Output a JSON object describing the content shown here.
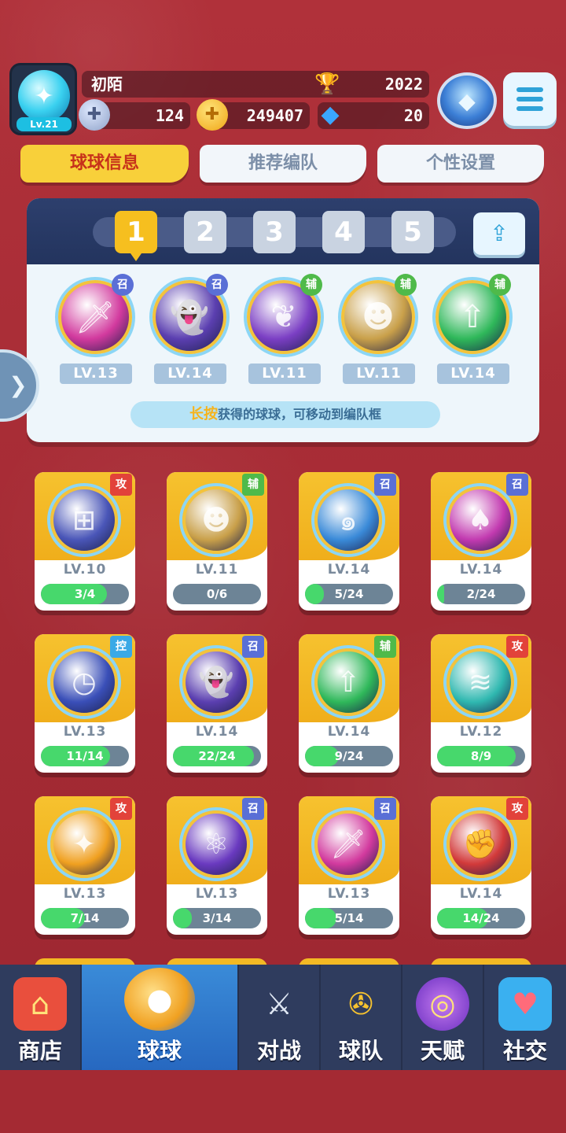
{
  "player": {
    "avatar_level": "Lv.21",
    "name": "初陌",
    "trophy_count": "2022",
    "energy": "124",
    "coins": "249407",
    "gems": "20"
  },
  "tabs": [
    {
      "label": "球球信息",
      "active": true
    },
    {
      "label": "推荐编队",
      "active": false
    },
    {
      "label": "个性设置",
      "active": false
    }
  ],
  "lineup": {
    "slots": [
      "1",
      "2",
      "3",
      "4",
      "5"
    ],
    "active_slot": "1",
    "balls": [
      {
        "role": "召",
        "level": "LV.13",
        "icon": "sword-icon",
        "color": "#d23a9e"
      },
      {
        "role": "召",
        "level": "LV.14",
        "icon": "ghost-icon",
        "color": "#5b3fb0"
      },
      {
        "role": "辅",
        "level": "LV.11",
        "icon": "leaf-icon",
        "color": "#7b3fc4"
      },
      {
        "role": "辅",
        "level": "LV.11",
        "icon": "people-icon",
        "color": "#c9a04a"
      },
      {
        "role": "辅",
        "level": "LV.14",
        "icon": "star-arrow-icon",
        "color": "#2fb85a"
      }
    ],
    "hint_bold": "长按",
    "hint_text": "获得的球球，可移动到编队框"
  },
  "balls": [
    {
      "type": "攻",
      "level": "LV.10",
      "progress": "3/4",
      "fill": 0.75,
      "icon": "dice-icon",
      "color": "#4a56b8"
    },
    {
      "type": "辅",
      "level": "LV.11",
      "progress": "0/6",
      "fill": 0.0,
      "icon": "people-icon",
      "color": "#c9a04a"
    },
    {
      "type": "召",
      "level": "LV.14",
      "progress": "5/24",
      "fill": 0.21,
      "icon": "vortex-icon",
      "color": "#3a8ad8"
    },
    {
      "type": "召",
      "level": "LV.14",
      "progress": "2/24",
      "fill": 0.08,
      "icon": "mushroom-icon",
      "color": "#c23ab0"
    },
    {
      "type": "控",
      "level": "LV.13",
      "progress": "11/14",
      "fill": 0.79,
      "icon": "clock-icon",
      "color": "#3a4fb8"
    },
    {
      "type": "召",
      "level": "LV.14",
      "progress": "22/24",
      "fill": 0.92,
      "icon": "ghost-icon",
      "color": "#5b3fb0"
    },
    {
      "type": "辅",
      "level": "LV.14",
      "progress": "9/24",
      "fill": 0.38,
      "icon": "star-arrow-icon",
      "color": "#2fb85a"
    },
    {
      "type": "攻",
      "level": "LV.12",
      "progress": "8/9",
      "fill": 0.89,
      "icon": "tornado-icon",
      "color": "#2fb8b0"
    },
    {
      "type": "攻",
      "level": "LV.13",
      "progress": "7/14",
      "fill": 0.5,
      "icon": "shuriken-icon",
      "color": "#f0a020"
    },
    {
      "type": "召",
      "level": "LV.13",
      "progress": "3/14",
      "fill": 0.21,
      "icon": "atom-icon",
      "color": "#6a3ac0"
    },
    {
      "type": "召",
      "level": "LV.13",
      "progress": "5/14",
      "fill": 0.36,
      "icon": "sword-icon",
      "color": "#d23a9e"
    },
    {
      "type": "攻",
      "level": "LV.14",
      "progress": "14/24",
      "fill": 0.58,
      "icon": "fist-icon",
      "color": "#d23a3a"
    }
  ],
  "nav": [
    {
      "label": "商店",
      "icon": "shop-icon",
      "active": false
    },
    {
      "label": "球球",
      "icon": "ball-icon",
      "active": true
    },
    {
      "label": "对战",
      "icon": "crossed-swords-icon",
      "active": false
    },
    {
      "label": "球队",
      "icon": "whistle-icon",
      "active": false
    },
    {
      "label": "天赋",
      "icon": "planet-icon",
      "active": false
    },
    {
      "label": "社交",
      "icon": "chat-heart-icon",
      "active": false
    }
  ]
}
